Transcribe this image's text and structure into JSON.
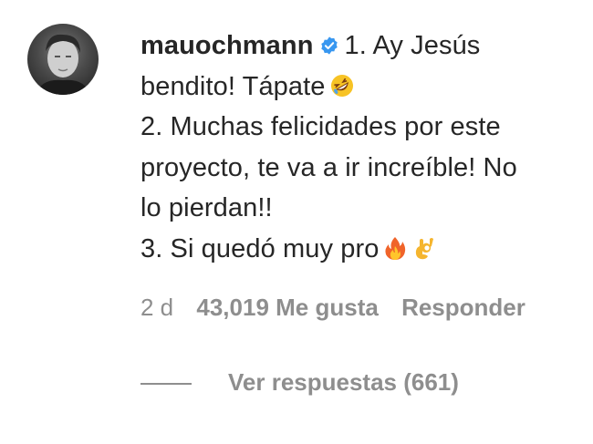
{
  "comment": {
    "username": "mauochmann",
    "verified": true,
    "lines": [
      "1. Ay Jesús",
      "bendito! Tápate",
      "2. Muchas felicidades por este",
      "proyecto, te va a ir increíble! No",
      "lo pierdan!!",
      "3. Si quedó muy pro"
    ],
    "emojis": {
      "line2": "rolling-on-floor-laughing-emoji",
      "line6": [
        "fire-emoji",
        "ok-hand-emoji"
      ]
    }
  },
  "meta": {
    "age": "2 d",
    "likes": "43,019 Me gusta",
    "reply_label": "Responder"
  },
  "view_replies": {
    "label": "Ver respuestas (661)"
  },
  "colors": {
    "text": "#262626",
    "secondary": "#8e8e8e",
    "verified": "#3897f0"
  }
}
